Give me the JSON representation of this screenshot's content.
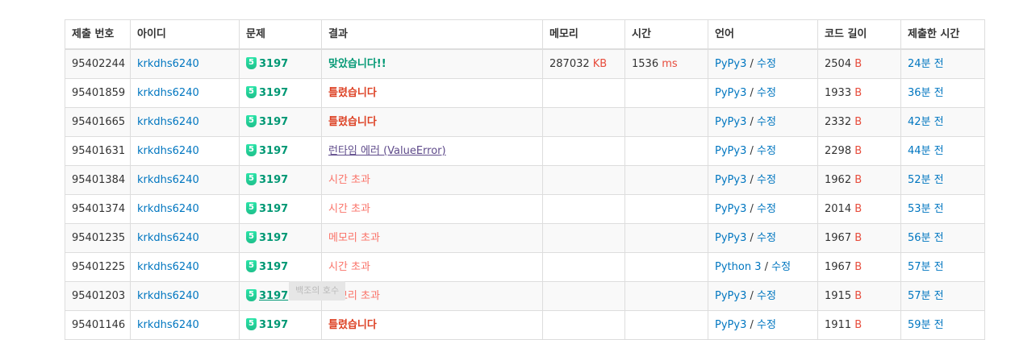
{
  "headers": [
    "제출 번호",
    "아이디",
    "문제",
    "결과",
    "메모리",
    "시간",
    "언어",
    "코드 길이",
    "제출한 시간"
  ],
  "units": {
    "memory": "KB",
    "time": "ms",
    "length": "B"
  },
  "edit_label": "수정",
  "tier_label": "5",
  "tooltip": "백조의 호수",
  "rows": [
    {
      "id": "95402244",
      "user": "krkdhs6240",
      "problem": "3197",
      "result": "맞았습니다!!",
      "result_type": "ac",
      "memory": "287032",
      "time": "1536",
      "lang": "PyPy3",
      "length": "2504",
      "submitted": "24분 전"
    },
    {
      "id": "95401859",
      "user": "krkdhs6240",
      "problem": "3197",
      "result": "틀렸습니다",
      "result_type": "wa",
      "memory": "",
      "time": "",
      "lang": "PyPy3",
      "length": "1933",
      "submitted": "36분 전"
    },
    {
      "id": "95401665",
      "user": "krkdhs6240",
      "problem": "3197",
      "result": "틀렸습니다",
      "result_type": "wa",
      "memory": "",
      "time": "",
      "lang": "PyPy3",
      "length": "2332",
      "submitted": "42분 전"
    },
    {
      "id": "95401631",
      "user": "krkdhs6240",
      "problem": "3197",
      "result": "런타임 에러 (ValueError)",
      "result_type": "rte",
      "memory": "",
      "time": "",
      "lang": "PyPy3",
      "length": "2298",
      "submitted": "44분 전"
    },
    {
      "id": "95401384",
      "user": "krkdhs6240",
      "problem": "3197",
      "result": "시간 초과",
      "result_type": "tle",
      "memory": "",
      "time": "",
      "lang": "PyPy3",
      "length": "1962",
      "submitted": "52분 전"
    },
    {
      "id": "95401374",
      "user": "krkdhs6240",
      "problem": "3197",
      "result": "시간 초과",
      "result_type": "tle",
      "memory": "",
      "time": "",
      "lang": "PyPy3",
      "length": "2014",
      "submitted": "53분 전"
    },
    {
      "id": "95401235",
      "user": "krkdhs6240",
      "problem": "3197",
      "result": "메모리 초과",
      "result_type": "tle",
      "memory": "",
      "time": "",
      "lang": "PyPy3",
      "length": "1967",
      "submitted": "56분 전"
    },
    {
      "id": "95401225",
      "user": "krkdhs6240",
      "problem": "3197",
      "result": "시간 초과",
      "result_type": "tle",
      "memory": "",
      "time": "",
      "lang": "Python 3",
      "length": "1967",
      "submitted": "57분 전"
    },
    {
      "id": "95401203",
      "user": "krkdhs6240",
      "problem": "3197",
      "result": "메모리 초과",
      "result_type": "tle",
      "memory": "",
      "time": "",
      "lang": "PyPy3",
      "length": "1915",
      "submitted": "57분 전",
      "hover": true
    },
    {
      "id": "95401146",
      "user": "krkdhs6240",
      "problem": "3197",
      "result": "틀렸습니다",
      "result_type": "wa",
      "memory": "",
      "time": "",
      "lang": "PyPy3",
      "length": "1911",
      "submitted": "59분 전"
    }
  ],
  "colors": {
    "accepted": "#009874",
    "wrong": "#dd4124",
    "tle": "#fa7268",
    "rte": "#5f4b8b",
    "link": "#0076c0",
    "unit": "#e74c3c",
    "tier": "#27e2a4"
  }
}
